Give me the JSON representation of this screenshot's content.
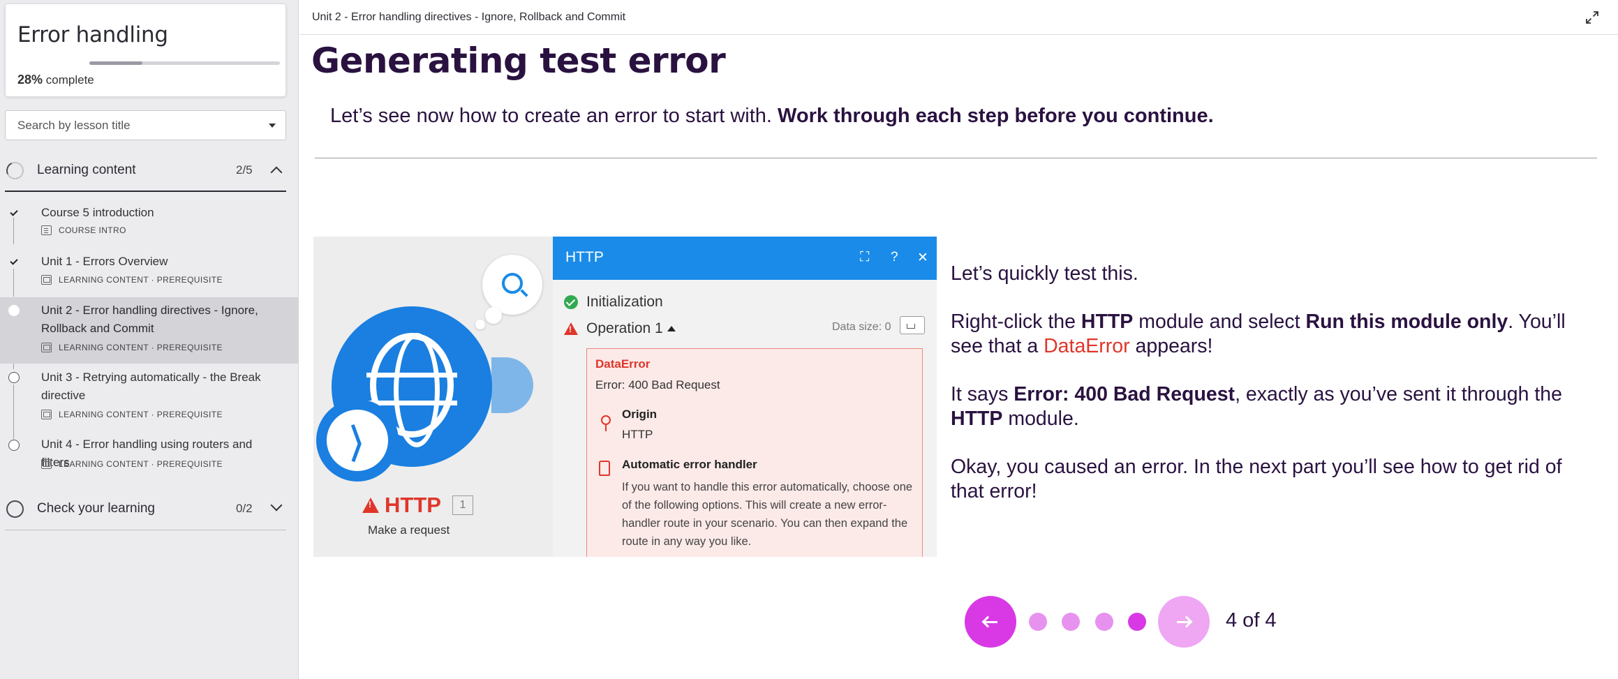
{
  "sidebar": {
    "course_title": "Error handling",
    "progress_percent": 28,
    "progress_label": "28%",
    "progress_suffix": "complete",
    "search_placeholder": "Search by lesson title",
    "sections": [
      {
        "label": "Learning content",
        "count": "2/5",
        "expanded": true
      },
      {
        "label": "Check your learning",
        "count": "0/2",
        "expanded": false
      }
    ],
    "lessons": [
      {
        "title": "Course 5 introduction",
        "meta": "COURSE INTRO",
        "status": "completed"
      },
      {
        "title": "Unit 1 - Errors Overview",
        "meta": "LEARNING CONTENT · PREREQUISITE",
        "status": "completed"
      },
      {
        "title": "Unit 2 - Error handling directives - Ignore, Rollback and Commit",
        "meta": "LEARNING CONTENT · PREREQUISITE",
        "status": "current"
      },
      {
        "title": "Unit 3 - Retrying automatically - the Break directive",
        "meta": "LEARNING CONTENT · PREREQUISITE",
        "status": "not-started"
      },
      {
        "title": "Unit 4 - Error handling using routers and filters",
        "meta": "LEARNING CONTENT · PREREQUISITE",
        "status": "not-started"
      }
    ]
  },
  "topbar": {
    "breadcrumb": "Unit 2 - Error handling directives - Ignore, Rollback and Commit",
    "expand_icon": "expand-icon"
  },
  "main": {
    "title": "Generating test error",
    "intro_plain": "Let’s see now how to create an error to start with. ",
    "intro_bold": "Work through each step before you continue.",
    "screenshot": {
      "panel_title": "HTTP",
      "init_label": "Initialization",
      "operation_label": "Operation 1",
      "data_size": "Data size: 0",
      "error_type": "DataError",
      "error_message": "Error: 400 Bad Request",
      "origin_label": "Origin",
      "origin_value": "HTTP",
      "handler_label": "Automatic error handler",
      "handler_text": "If you want to handle this error automatically, choose one of the following options. This will create a new error-handler route in your scenario. You can then expand the route in any way you like.",
      "module_name": "HTTP",
      "module_badge": "1",
      "module_sub": "Make a request"
    },
    "body": {
      "p1": "Let’s quickly test this.",
      "p2_a": "Right-click the ",
      "p2_b": "HTTP",
      "p2_c": " module and select ",
      "p2_d": "Run this module only",
      "p2_e": ". You’ll see that a ",
      "p2_f": "DataError",
      "p2_g": " appears!",
      "p3_a": "It says ",
      "p3_b": "Error: 400 Bad Request",
      "p3_c": ", exactly as you’ve sent it through the ",
      "p3_d": "HTTP",
      "p3_e": " module.",
      "p4": "Okay, you caused an error. In the next part you’ll see how to get rid of that error!"
    },
    "pagination": {
      "current": 4,
      "total": 4,
      "label": "4 of 4",
      "prev_icon": "arrow-left-icon",
      "next_icon": "arrow-right-icon"
    }
  },
  "colors": {
    "accent": "#d839e5",
    "accent_light": "#efa6f3",
    "heading": "#2a1240",
    "error": "#e0362a",
    "panel_blue": "#1a8be8"
  }
}
